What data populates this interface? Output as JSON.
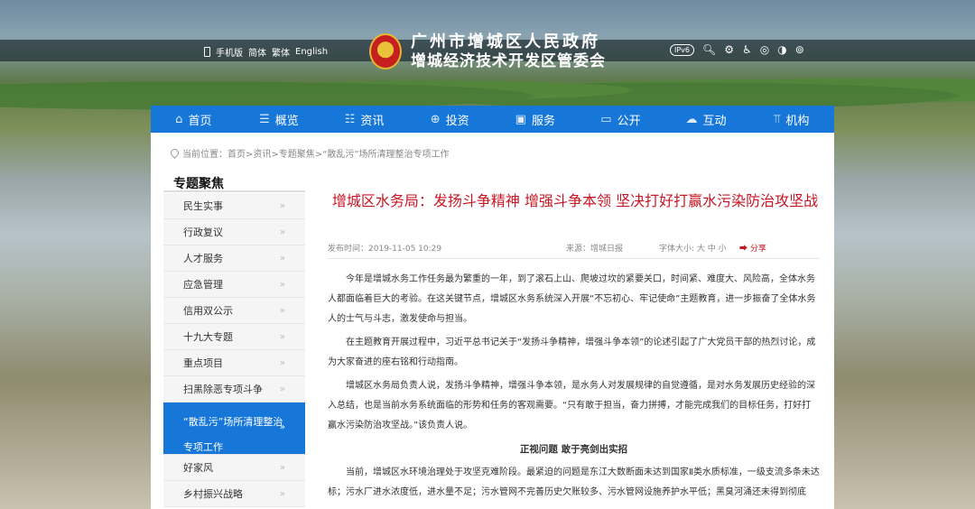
{
  "top": {
    "mobile": "手机版",
    "simplified": "简体",
    "traditional": "繁体",
    "english": "English",
    "ipv6": "IPv6"
  },
  "logo": {
    "line1": "广州市增城区人民政府",
    "line2": "增城经济技术开发区管委会"
  },
  "nav": [
    "首页",
    "概览",
    "资讯",
    "投资",
    "服务",
    "公开",
    "互动",
    "机构"
  ],
  "breadcrumb": "当前位置：首页>资讯>专题聚焦>“散乱污”场所清理整治专项工作",
  "sidebar": {
    "title": "专题聚焦",
    "items": [
      "民生实事",
      "行政复议",
      "人才服务",
      "应急管理",
      "信用双公示",
      "十九大专题",
      "重点项目",
      "扫黑除恶专项斗争",
      "“散乱污”场所清理整治专项工作",
      "好家风",
      "乡村振兴战略"
    ]
  },
  "article": {
    "title": "增城区水务局：发扬斗争精神 增强斗争本领 坚决打好打赢水污染防治攻坚战",
    "date": "发布时间：2019-11-05 10:29",
    "source": "来源：增城日报",
    "fontsize": "字体大小: 大 中 小",
    "share": "分享",
    "p1": "今年是增城水务工作任务最为繁重的一年，到了滚石上山、爬坡过坎的紧要关口，时间紧、难度大、风险高，全体水务人都面临着巨大的考验。在这关键节点，增城区水务系统深入开展“不忘初心、牢记使命”主题教育，进一步振奋了全体水务人的士气与斗志，激发使命与担当。",
    "p2": "在主题教育开展过程中，习近平总书记关于“发扬斗争精神，增强斗争本领”的论述引起了广大党员干部的热烈讨论，成为大家奋进的座右铭和行动指南。",
    "p3": "增城区水务局负责人说，发扬斗争精神，增强斗争本领，是水务人对发展规律的自觉遵循，是对水务发展历史经验的深入总结，也是当前水务系统面临的形势和任务的客观需要。“只有敢于担当，奋力拼搏，才能完成我们的目标任务，打好打赢水污染防治攻坚战。”该负责人说。",
    "subhead": "正视问题 敢于亮剑出实招",
    "p4": "当前，增城区水环境治理处于攻坚克难阶段。最紧迫的问题是东江大数断面未达到国家Ⅱ类水质标准，一级支流多条未达标；污水厂进水浓度低，进水量不足；污水管网不完善历史欠账较多、污水管网设施养护水平低；黑臭河涌还未得到彻底"
  }
}
